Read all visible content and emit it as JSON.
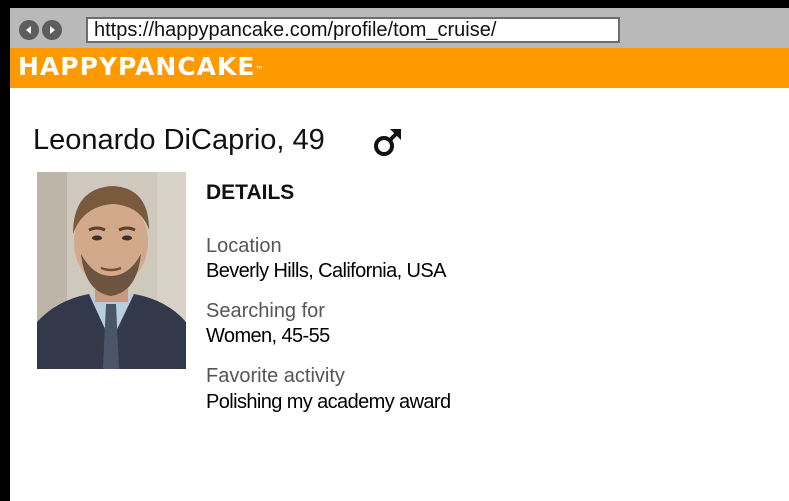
{
  "browser": {
    "url": "https://happypancake.com/profile/tom_cruise/",
    "back_icon": "back-arrow-icon",
    "forward_icon": "forward-arrow-icon"
  },
  "brand": {
    "logo_text": "HAPPYPANCAKE",
    "trademark": "™",
    "color": "#ff9900"
  },
  "profile": {
    "name_age": "Leonardo DiCaprio, 49",
    "gender_icon": "male-symbol-icon",
    "photo_alt": "Leonardo DiCaprio"
  },
  "details": {
    "heading": "DETAILS",
    "fields": [
      {
        "label": "Location",
        "value": "Beverly Hills, California, USA"
      },
      {
        "label": "Searching for",
        "value": "Women, 45-55"
      },
      {
        "label": "Favorite activity",
        "value": "Polishing my academy award"
      }
    ]
  }
}
